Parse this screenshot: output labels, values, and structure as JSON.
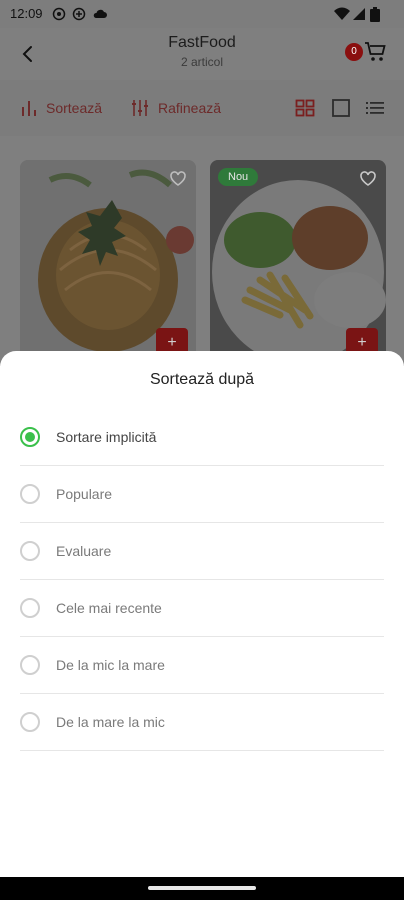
{
  "status_bar": {
    "time": "12:09",
    "icons": [
      "whatsapp-icon",
      "settings-icon",
      "cloud-icon",
      "wifi-icon",
      "signal-icon",
      "battery-icon"
    ]
  },
  "header": {
    "title": "FastFood",
    "subtitle": "2 articol",
    "cart_count": "0"
  },
  "toolbar": {
    "sort_label": "Sortează",
    "refine_label": "Rafinează",
    "accent": "#e53935"
  },
  "products": [
    {
      "image": "spaghetti",
      "badge": ""
    },
    {
      "image": "chicken-fries",
      "badge": "Nou"
    }
  ],
  "sort_sheet": {
    "title": "Sortează după",
    "options": [
      {
        "label": "Sortare implicită",
        "selected": true
      },
      {
        "label": "Populare",
        "selected": false
      },
      {
        "label": "Evaluare",
        "selected": false
      },
      {
        "label": "Cele mai recente",
        "selected": false
      },
      {
        "label": "De la mic la mare",
        "selected": false
      },
      {
        "label": "De la mare la mic",
        "selected": false
      }
    ],
    "selected_color": "#3ac04b"
  }
}
